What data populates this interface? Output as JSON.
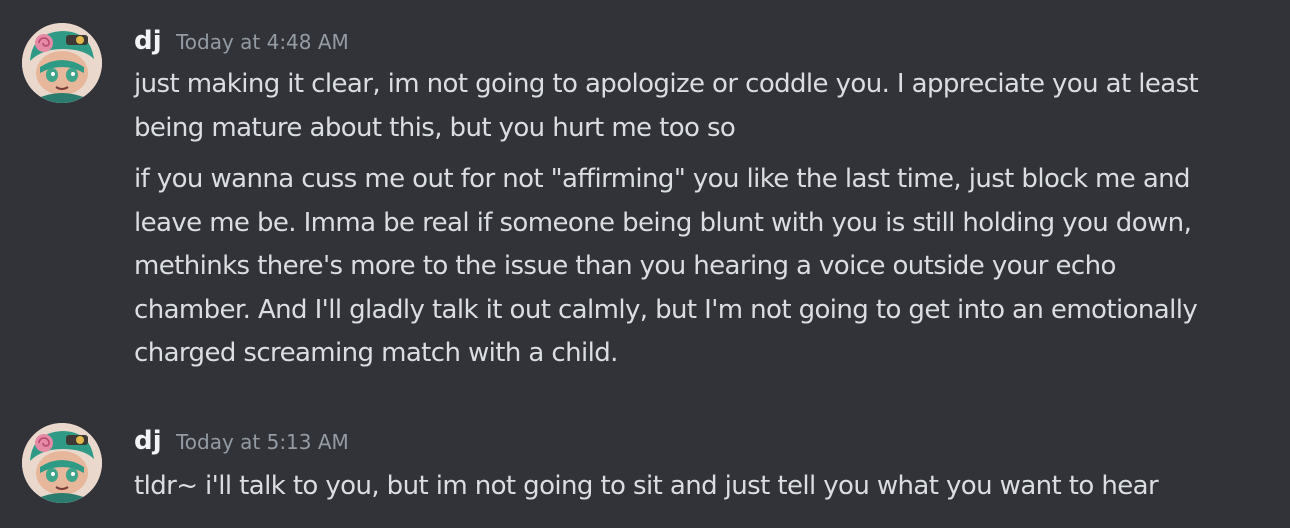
{
  "messages": [
    {
      "username": "dj",
      "timestamp": "Today at 4:48 AM",
      "paragraphs": [
        [
          "just making it clear, im not going to apologize or coddle you. I appreciate you at least",
          "being mature about this, but you hurt me too so"
        ],
        [
          "if you wanna cuss me out for not \"affirming\" you like the last time, just block me and",
          "leave me be. Imma be real if someone being blunt with you is still holding you down,",
          "methinks there's more to the issue than you hearing a voice outside your echo",
          "chamber. And I'll gladly talk it out calmly, but I'm not going to get into an emotionally",
          "charged screaming match with a child."
        ]
      ]
    },
    {
      "username": "dj",
      "timestamp": "Today at 5:13 AM",
      "paragraphs": [
        [
          "tldr~ i'll talk to you, but im not going to sit and just tell you what you want to hear"
        ]
      ]
    }
  ]
}
